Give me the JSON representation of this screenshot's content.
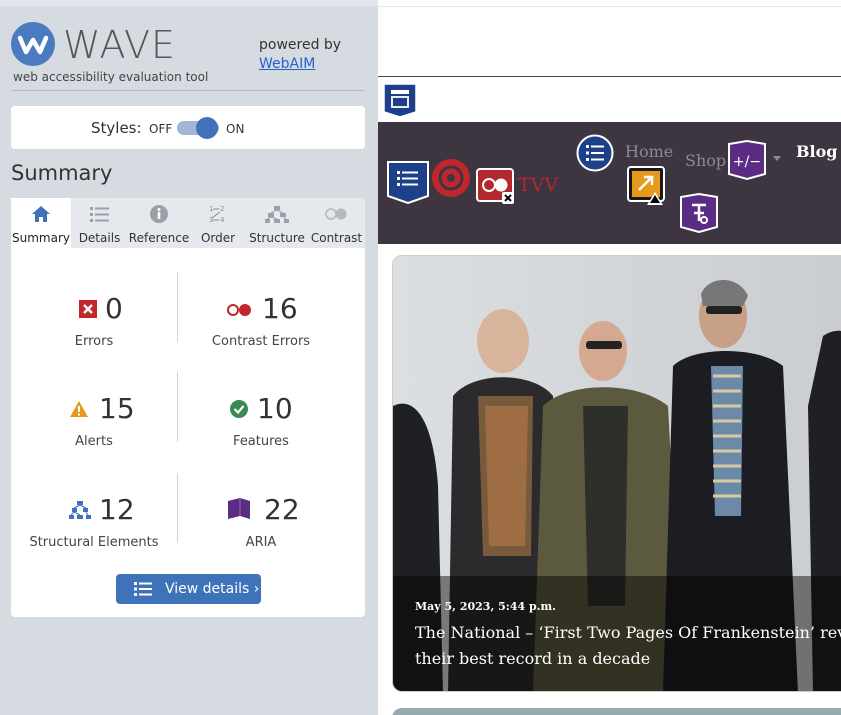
{
  "wave": {
    "brand": "WAVE",
    "tagline": "web accessibility evaluation tool",
    "powered_by": "powered by",
    "webaim_link": "WebAIM",
    "styles": {
      "label": "Styles:",
      "off": "OFF",
      "on": "ON",
      "state": "on"
    },
    "summary_heading": "Summary",
    "tabs": [
      {
        "label": "Summary",
        "icon": "home-icon",
        "active": true
      },
      {
        "label": "Details",
        "icon": "list-icon",
        "active": false
      },
      {
        "label": "Reference",
        "icon": "info-icon",
        "active": false
      },
      {
        "label": "Order",
        "icon": "order-icon",
        "active": false
      },
      {
        "label": "Structure",
        "icon": "structure-icon",
        "active": false
      },
      {
        "label": "Contrast",
        "icon": "contrast-icon",
        "active": false
      }
    ],
    "stats": {
      "errors": {
        "value": "0",
        "label": "Errors"
      },
      "contrast_errors": {
        "value": "16",
        "label": "Contrast Errors"
      },
      "alerts": {
        "value": "15",
        "label": "Alerts"
      },
      "features": {
        "value": "10",
        "label": "Features"
      },
      "structural": {
        "value": "12",
        "label": "Structural Elements"
      },
      "aria": {
        "value": "22",
        "label": "ARIA"
      }
    },
    "view_details": "View details ›",
    "colors": {
      "accent": "#3f73b9",
      "error": "#c0272d",
      "alert": "#e69a1d",
      "feature": "#3a8a4f",
      "aria": "#5b2c83"
    }
  },
  "page": {
    "nav": {
      "home": "Home",
      "shop": "Shop",
      "blog": "Blog",
      "brand_text": "TVV"
    },
    "article": {
      "date": "May 5, 2023, 5:44 p.m.",
      "headline_line1": "The National – ‘First Two Pages Of Frankenstein’ review:",
      "headline_line2": "their best record in a decade"
    }
  }
}
